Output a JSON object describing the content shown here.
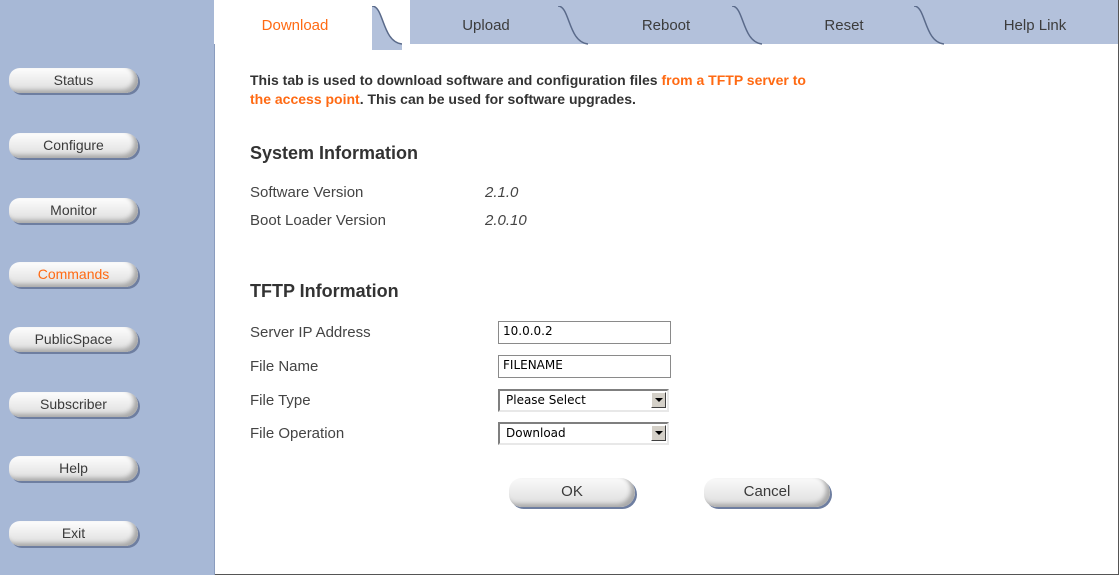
{
  "tabs": [
    {
      "label": "Download",
      "active": true
    },
    {
      "label": "Upload",
      "active": false
    },
    {
      "label": "Reboot",
      "active": false
    },
    {
      "label": "Reset",
      "active": false
    },
    {
      "label": "Help Link",
      "active": false
    }
  ],
  "sidebar": {
    "items": [
      {
        "label": "Status"
      },
      {
        "label": "Configure"
      },
      {
        "label": "Monitor"
      },
      {
        "label": "Commands",
        "active": true
      },
      {
        "label": "PublicSpace"
      },
      {
        "label": "Subscriber"
      },
      {
        "label": "Help"
      },
      {
        "label": "Exit"
      }
    ]
  },
  "intro": {
    "part1": "This tab is used to download software and configuration files ",
    "highlight1": "from a TFTP server to",
    "highlight2": "the access point",
    "part2": ". This can be used for software upgrades."
  },
  "system_info": {
    "title": "System Information",
    "software_version_label": "Software Version",
    "software_version": "2.1.0",
    "boot_loader_label": "Boot Loader Version",
    "boot_loader_version": "2.0.10"
  },
  "tftp_info": {
    "title": "TFTP Information",
    "server_ip_label": "Server IP Address",
    "server_ip_value": "10.0.0.2",
    "file_name_label": "File Name",
    "file_name_value": "FILENAME",
    "file_type_label": "File Type",
    "file_type_value": "Please Select",
    "file_operation_label": "File Operation",
    "file_operation_value": "Download"
  },
  "actions": {
    "ok_label": "OK",
    "cancel_label": "Cancel"
  },
  "colors": {
    "accent": "#ff6a13",
    "sidebar_bg": "#a7b8d6",
    "tabbar_bg": "#b3c1db"
  }
}
